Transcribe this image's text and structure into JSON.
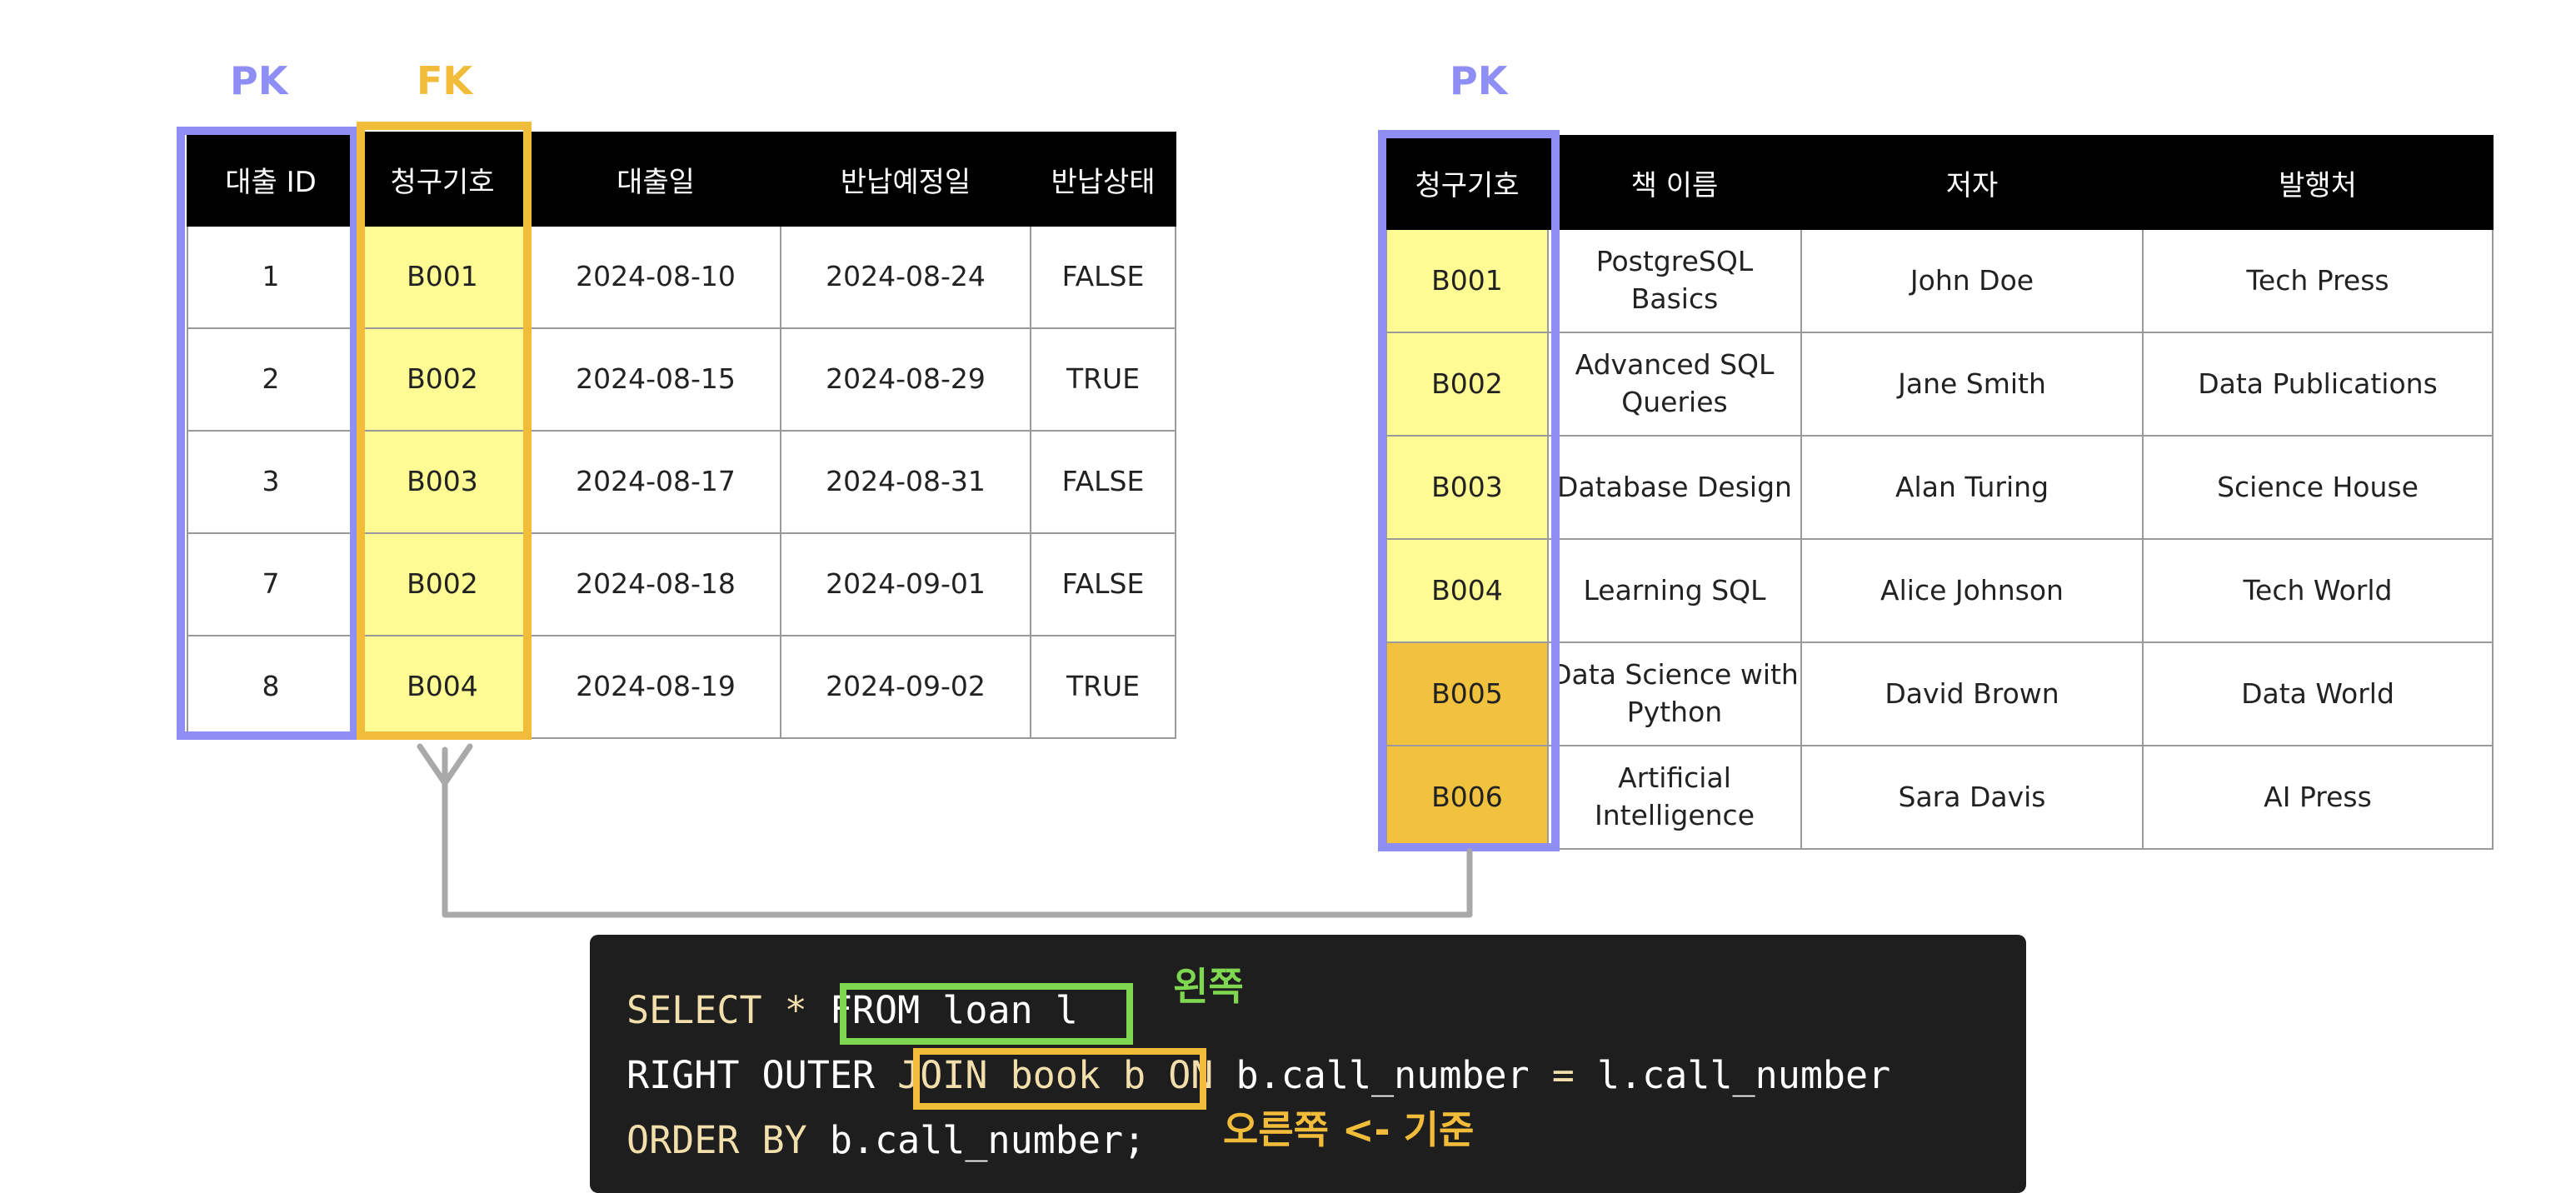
{
  "labels": {
    "loan_pk": "PK",
    "loan_fk": "FK",
    "book_pk": "PK"
  },
  "colors": {
    "pk_border": "#8e8ef5",
    "fk_border": "#f2bc3b",
    "fk_cell": "#fefa94",
    "unmatched_cell": "#f1c23e",
    "header_bg": "#000000",
    "code_bg": "#1e1e1e",
    "left_highlight": "#7fd650",
    "right_highlight": "#f2bc3b",
    "connector": "#a9a9a9"
  },
  "loan_table": {
    "headers": [
      "대출 ID",
      "청구기호",
      "대출일",
      "반납예정일",
      "반납상태"
    ],
    "rows": [
      [
        "1",
        "B001",
        "2024-08-10",
        "2024-08-24",
        "FALSE"
      ],
      [
        "2",
        "B002",
        "2024-08-15",
        "2024-08-29",
        "TRUE"
      ],
      [
        "3",
        "B003",
        "2024-08-17",
        "2024-08-31",
        "FALSE"
      ],
      [
        "7",
        "B002",
        "2024-08-18",
        "2024-09-01",
        "FALSE"
      ],
      [
        "8",
        "B004",
        "2024-08-19",
        "2024-09-02",
        "TRUE"
      ]
    ]
  },
  "book_table": {
    "headers": [
      "청구기호",
      "책 이름",
      "저자",
      "발행처"
    ],
    "rows": [
      [
        "B001",
        "PostgreSQL Basics",
        "John Doe",
        "Tech Press"
      ],
      [
        "B002",
        "Advanced SQL Queries",
        "Jane Smith",
        "Data Publications"
      ],
      [
        "B003",
        "Database Design",
        "Alan Turing",
        "Science House"
      ],
      [
        "B004",
        "Learning SQL",
        "Alice Johnson",
        "Tech World"
      ],
      [
        "B005",
        "Data Science with Python",
        "David Brown",
        "Data World"
      ],
      [
        "B006",
        "Artificial Intelligence",
        "Sara Davis",
        "AI Press"
      ]
    ]
  },
  "code": {
    "line1_select": "SELECT",
    "line1_star": "*",
    "line1_from": "FROM loan l",
    "line2_right_outer": "RIGHT OUTER",
    "line2_join": "JOIN book b",
    "line2_on": "ON",
    "line2_left_expr": "b.call_number",
    "line2_eq": "=",
    "line2_right_expr": "l.call_number",
    "line3_order_by": "ORDER BY",
    "line3_expr": "b.call_number;"
  },
  "annotations": {
    "left": "왼쪽",
    "right": "오른쪽 <- 기준"
  }
}
